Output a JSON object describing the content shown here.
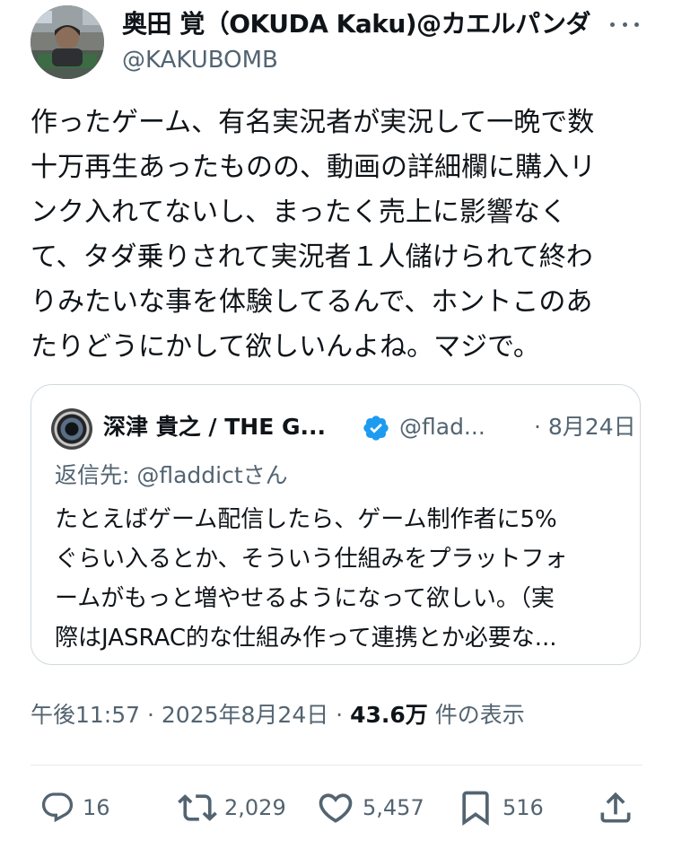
{
  "author": {
    "display_name": "奥田 覚（OKUDA Kaku)@カエルパンダ",
    "handle": "@KAKUBOMB"
  },
  "tweet": {
    "lines": [
      "作ったゲーム、有名実況者が実況して一晩で数",
      "十万再生あったものの、動画の詳細欄に購入リ",
      "ンク入れてないし、まったく売上に影響なく",
      "て、タダ乗りされて実況者１人儲けられて終わ",
      "りみたいな事を体験してるんで、ホントこのあ",
      "たりどうにかして欲しいんよね。マジで。"
    ]
  },
  "quote": {
    "name": "深津 貴之 / THE G...",
    "handle": "@flad...",
    "date": "· 8月24日",
    "reply_to": "返信先: @fladdictさん",
    "lines": [
      "たとえばゲーム配信したら、ゲーム制作者に5%",
      "ぐらい入るとか、そういう仕組みをプラットフォ",
      "ームがもっと増やせるようになって欲しい。（実",
      "際はJASRAC的な仕組み作って連携とか必要な..."
    ]
  },
  "meta": {
    "time": "午後11:57",
    "sep1": " · ",
    "date": "2025年8月24日",
    "sep2": " · ",
    "views": "43.6万",
    "views_label": " 件の表示"
  },
  "actions": {
    "replies": "16",
    "reposts": "2,029",
    "likes": "5,457",
    "bookmarks": "516"
  },
  "colors": {
    "text": "#0f1419",
    "secondary": "#536471",
    "verified": "#1d9bf0",
    "border": "#cfd9de"
  }
}
